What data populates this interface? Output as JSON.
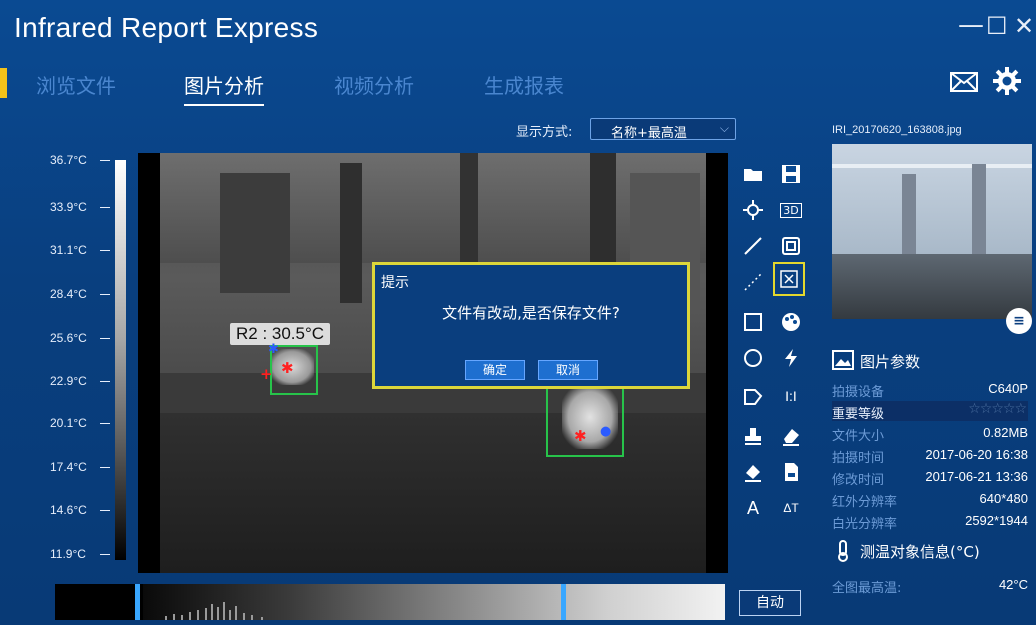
{
  "window": {
    "title": "Infrared Report Express",
    "minimize_glyph": "—",
    "maximize_glyph": "☐",
    "close_glyph": "✕"
  },
  "tabs": [
    {
      "label": "浏览文件",
      "active": false
    },
    {
      "label": "图片分析",
      "active": true
    },
    {
      "label": "视频分析",
      "active": false
    },
    {
      "label": "生成报表",
      "active": false
    }
  ],
  "top_icons": [
    "mail-icon",
    "gear-icon"
  ],
  "display_mode": {
    "label": "显示方式:",
    "selected": "名称+最高温"
  },
  "temperature_scale": {
    "labels": [
      "36.7°C",
      "33.9°C",
      "31.1°C",
      "28.4°C",
      "25.6°C",
      "22.9°C",
      "20.1°C",
      "17.4°C",
      "14.6°C",
      "11.9°C"
    ]
  },
  "thermal_image": {
    "roi_label": "R2 : 30.5°C"
  },
  "dialog": {
    "title": "提示",
    "message": "文件有改动,是否保存文件?",
    "ok_label": "确定",
    "cancel_label": "取消"
  },
  "tools": {
    "three_d_label": "3D",
    "ratio_label": "I:I",
    "text_tool_label": "A",
    "delta_t_label": "ΔT"
  },
  "right_panel": {
    "filename": "IRI_20170620_163808.jpg",
    "info_glyph": "≡",
    "params_title": "图片参数",
    "params": [
      {
        "key": "拍摄设备",
        "value": "C640P"
      },
      {
        "key": "重要等级",
        "value": "☆☆☆☆☆"
      },
      {
        "key": "文件大小",
        "value": "0.82MB"
      },
      {
        "key": "拍摄时间",
        "value": "2017-06-20 16:38"
      },
      {
        "key": "修改时间",
        "value": "2017-06-21 13:36"
      },
      {
        "key": "红外分辨率",
        "value": "640*480"
      },
      {
        "key": "白光分辨率",
        "value": "2592*1944"
      }
    ],
    "measure_title": "测温对象信息(°C)",
    "measure_rows": [
      {
        "key": "全图最高温:",
        "value": "42°C"
      }
    ]
  },
  "auto_button_label": "自动",
  "colors": {
    "background": "#0a4a92",
    "accent_yellow": "#f3c21a",
    "inactive_tab": "#4a86cf",
    "roi_green": "#27c34a",
    "dialog_border": "#dcd63a"
  }
}
